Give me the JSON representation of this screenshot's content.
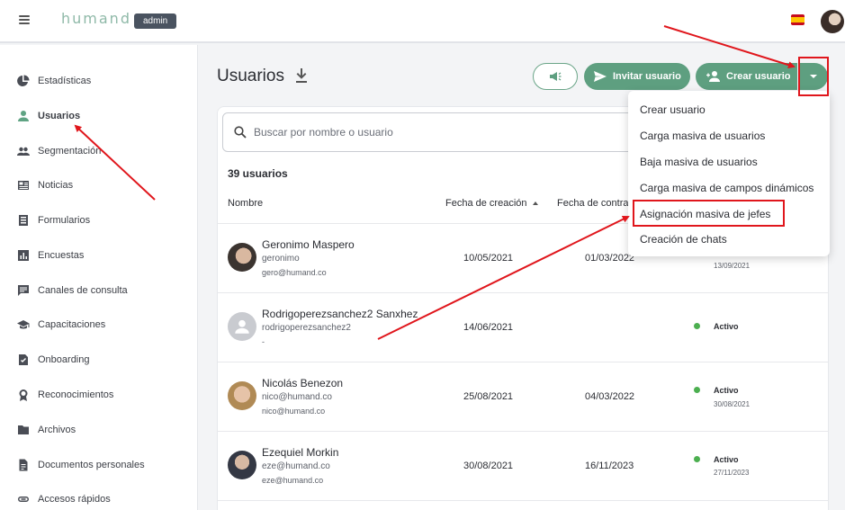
{
  "topbar": {
    "logo": "humand",
    "badge": "admin",
    "language_icon": "spain-flag-icon"
  },
  "sidebar": {
    "items": [
      {
        "label": "Estadísticas",
        "icon": "pie-chart-icon"
      },
      {
        "label": "Usuarios",
        "icon": "person-icon",
        "active": true
      },
      {
        "label": "Segmentación",
        "icon": "group-icon"
      },
      {
        "label": "Noticias",
        "icon": "newspaper-icon"
      },
      {
        "label": "Formularios",
        "icon": "form-icon"
      },
      {
        "label": "Encuestas",
        "icon": "bar-chart-icon"
      },
      {
        "label": "Canales de consulta",
        "icon": "chat-icon"
      },
      {
        "label": "Capacitaciones",
        "icon": "graduation-cap-icon"
      },
      {
        "label": "Onboarding",
        "icon": "checklist-icon"
      },
      {
        "label": "Reconocimientos",
        "icon": "medal-icon"
      },
      {
        "label": "Archivos",
        "icon": "folder-icon"
      },
      {
        "label": "Documentos personales",
        "icon": "document-icon"
      },
      {
        "label": "Accesos rápidos",
        "icon": "link-icon"
      }
    ]
  },
  "main": {
    "title": "Usuarios",
    "buttons": {
      "invite": "Invitar usuario",
      "create": "Crear usuario"
    },
    "search_placeholder": "Buscar por nombre o usuario",
    "count": "39 usuarios",
    "columns": {
      "name": "Nombre",
      "created": "Fecha de creación",
      "hire": "Fecha de contra"
    },
    "rows": [
      {
        "name": "Geronimo Maspero",
        "username": "geronimo",
        "email": "gero@humand.co",
        "created": "10/05/2021",
        "hire": "01/03/2022",
        "status": "",
        "status_date": "13/09/2021"
      },
      {
        "name": "Rodrigoperezsanchez2 Sanxhez",
        "username": "rodrigoperezsanchez2",
        "email": "-",
        "created": "14/06/2021",
        "hire": "",
        "status": "Activo",
        "status_date": ""
      },
      {
        "name": "Nicolás Benezon",
        "username": "nico@humand.co",
        "email": "nico@humand.co",
        "created": "25/08/2021",
        "hire": "04/03/2022",
        "status": "Activo",
        "status_date": "30/08/2021"
      },
      {
        "name": "Ezequiel Morkin",
        "username": "eze@humand.co",
        "email": "eze@humand.co",
        "created": "30/08/2021",
        "hire": "16/11/2023",
        "status": "Activo",
        "status_date": "27/11/2023"
      }
    ]
  },
  "menu": {
    "items": [
      "Crear usuario",
      "Carga masiva de usuarios",
      "Baja masiva de usuarios",
      "Carga masiva de campos dinámicos",
      "Asignación masiva de jefes",
      "Creación de chats"
    ]
  },
  "colors": {
    "accent": "#5e9f80",
    "annotation": "#e0161c",
    "active_status": "#4caf50"
  }
}
